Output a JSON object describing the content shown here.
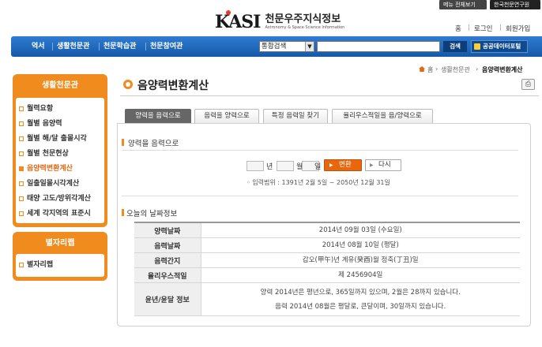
{
  "top": {
    "menu_all": "메뉴 전체보기",
    "kasi": "한국천문연구원"
  },
  "logo": {
    "mark": "KASI",
    "title": "천문우주지식정보",
    "subtitle": "Astronomy & Space Science Information"
  },
  "member": {
    "home": "홈",
    "login": "로그인",
    "join": "회원가입"
  },
  "nav": {
    "items": [
      "역서",
      "생활천문관",
      "천문학습관",
      "천문참여관"
    ],
    "search_select": "통합검색",
    "search_button": "검색",
    "opendata": "공공데이터포털"
  },
  "sidebar": {
    "box1_title": "생활천문관",
    "items": [
      "월력요항",
      "월별 음양력",
      "월별 해/달 출몰시각",
      "월별 천문현상",
      "음양력변환계산",
      "일출일몰시각계산",
      "태양 고도/방위각계산",
      "세계 각지역의 표준시"
    ],
    "active_index": 4,
    "box2_title": "별자리랩",
    "box2_items": [
      "별자리랩"
    ]
  },
  "breadcrumb": {
    "home": "홈",
    "level1": "생활천문관",
    "current": "음양력변환계산"
  },
  "page_title": "음양력변환계산",
  "tabs": [
    "양력을 음력으로",
    "음력을 양력으로",
    "특정 음력일 찾기",
    "율리우스적일을 음/양력으로"
  ],
  "converter": {
    "section_title": "양력을 음력으로",
    "year": "년",
    "month": "월",
    "day": "일",
    "convert_button": "변환",
    "reset_button": "다시",
    "range_text": "입력범위 : 1391년 2월 5일 ~ 2050년 12월 31일"
  },
  "today": {
    "section_title": "오늘의 날짜정보",
    "rows": [
      {
        "label": "양력날짜",
        "value": "2014년 09월 03일 (수요일)"
      },
      {
        "label": "음력날짜",
        "value": "2014년 08월 10일 (평달)"
      },
      {
        "label": "음력간지",
        "value": "갑오(甲午)년 계유(癸酉)월 정축(丁丑)일"
      },
      {
        "label": "율리우스적일",
        "value": "제 2456904일"
      },
      {
        "label": "윤년/윤달 정보",
        "line1": "양력 2014년은 평년으로, 365일까지 있으며, 2월은 28까지 있습니다.",
        "line2": "음력 2014년 08월은 평달로, 큰달이며, 30일까지 있습니다."
      }
    ]
  },
  "colors": {
    "nav_blue": "#1f6bbf",
    "accent_orange": "#f08c1e",
    "button_orange": "#e8660c"
  }
}
